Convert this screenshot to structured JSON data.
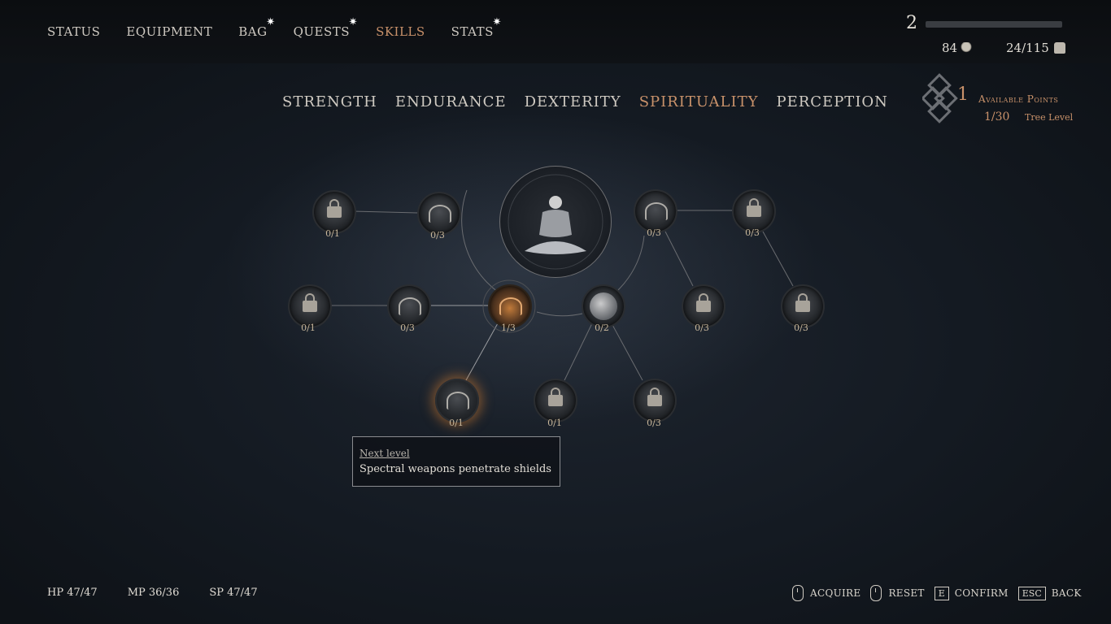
{
  "nav": {
    "items": [
      {
        "label": "STATUS",
        "star": false,
        "active": false
      },
      {
        "label": "EQUIPMENT",
        "star": false,
        "active": false
      },
      {
        "label": "BAG",
        "star": true,
        "active": false
      },
      {
        "label": "QUESTS",
        "star": true,
        "active": false
      },
      {
        "label": "SKILLS",
        "star": false,
        "active": true
      },
      {
        "label": "STATS",
        "star": true,
        "active": false
      }
    ],
    "star_glyph": "✷"
  },
  "player": {
    "level": "2",
    "xp_fraction": 0.0,
    "gold": "84",
    "weight": "24/115"
  },
  "tree_tabs": [
    "STRENGTH",
    "ENDURANCE",
    "DEXTERITY",
    "SPIRITUALITY",
    "PERCEPTION"
  ],
  "active_tree": "SPIRITUALITY",
  "points": {
    "available": "1",
    "available_label": "Available Points",
    "tree_level": "1/30",
    "tree_level_label": "Tree Level"
  },
  "nodes": [
    {
      "id": "n1",
      "icon": "lock-icon",
      "count": "0/1"
    },
    {
      "id": "n2",
      "icon": "flame-icon",
      "count": "0/3"
    },
    {
      "id": "n3",
      "icon": "flame-icon",
      "count": "0/3"
    },
    {
      "id": "n4",
      "icon": "lock-icon",
      "count": "0/3"
    },
    {
      "id": "n5",
      "icon": "lock-icon",
      "count": "0/1"
    },
    {
      "id": "n6",
      "icon": "flame-icon",
      "count": "0/3"
    },
    {
      "id": "n7",
      "icon": "flame-icon",
      "count": "1/3"
    },
    {
      "id": "n8",
      "icon": "orb-icon",
      "count": "0/2"
    },
    {
      "id": "n9",
      "icon": "lock-icon",
      "count": "0/3"
    },
    {
      "id": "n10",
      "icon": "lock-icon",
      "count": "0/3"
    },
    {
      "id": "n11",
      "icon": "shield-icon",
      "count": "0/1"
    },
    {
      "id": "n12",
      "icon": "lock-icon",
      "count": "0/1"
    },
    {
      "id": "n13",
      "icon": "lock-icon",
      "count": "0/3"
    }
  ],
  "tooltip": {
    "title": "Next level",
    "body": "Spectral weapons penetrate shields"
  },
  "stats": {
    "hp": "HP 47/47",
    "mp": "MP 36/36",
    "sp": "SP 47/47"
  },
  "controls": {
    "acquire": "ACQUIRE",
    "reset": "RESET",
    "confirm_key": "E",
    "confirm": "CONFIRM",
    "back_key": "ESC",
    "back": "BACK"
  }
}
